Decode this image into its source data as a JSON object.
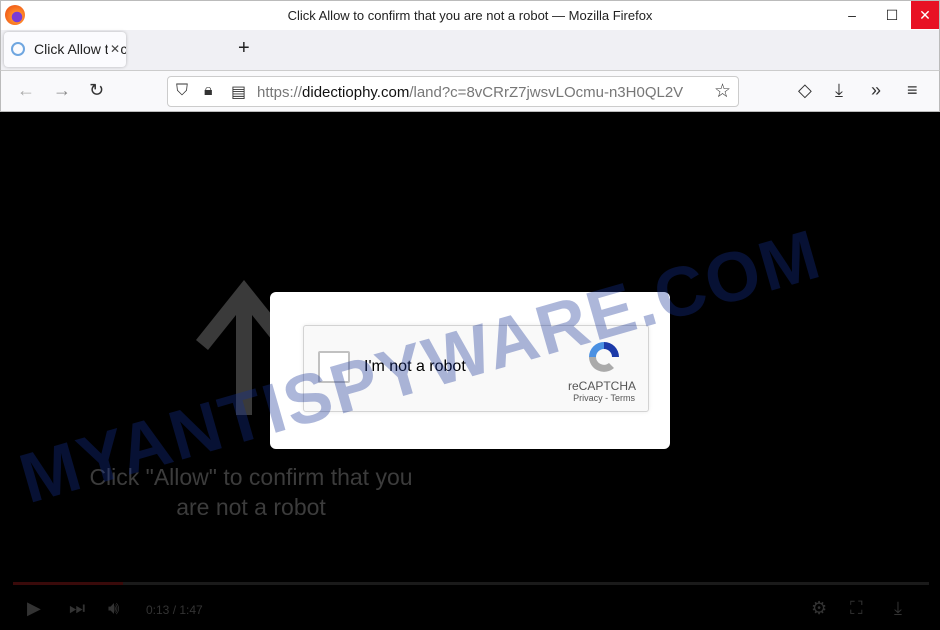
{
  "window": {
    "title": "Click Allow to confirm that you are not a robot — Mozilla Firefox",
    "minimize": "–",
    "maximize": "☐",
    "close": "✕"
  },
  "tab": {
    "label": "Click Allow to confirm that you are not a robot",
    "close": "✕",
    "new_tab": "+"
  },
  "nav": {
    "back": "←",
    "forward": "→",
    "reload": "↻",
    "url_prefix": "https://",
    "url_domain": "didectiophy.com",
    "url_path": "/land?c=8vCRrZ7jwsvLOcmu-n3H0QL2V",
    "bookmark": "☆",
    "pocket": "◇",
    "downloads": "⤓",
    "overflow": "»",
    "menu": "≡"
  },
  "page": {
    "message": "Click \"Allow\" to confirm that you are not a robot",
    "watermark": "MYANTISPYWARE.COM",
    "captcha": {
      "label": "I'm not a robot",
      "brand": "reCAPTCHA",
      "privacy": "Privacy",
      "sep": " - ",
      "terms": "Terms",
      "checked": false
    },
    "video": {
      "time": "0:13 / 1:47",
      "progress": 0.12
    }
  }
}
